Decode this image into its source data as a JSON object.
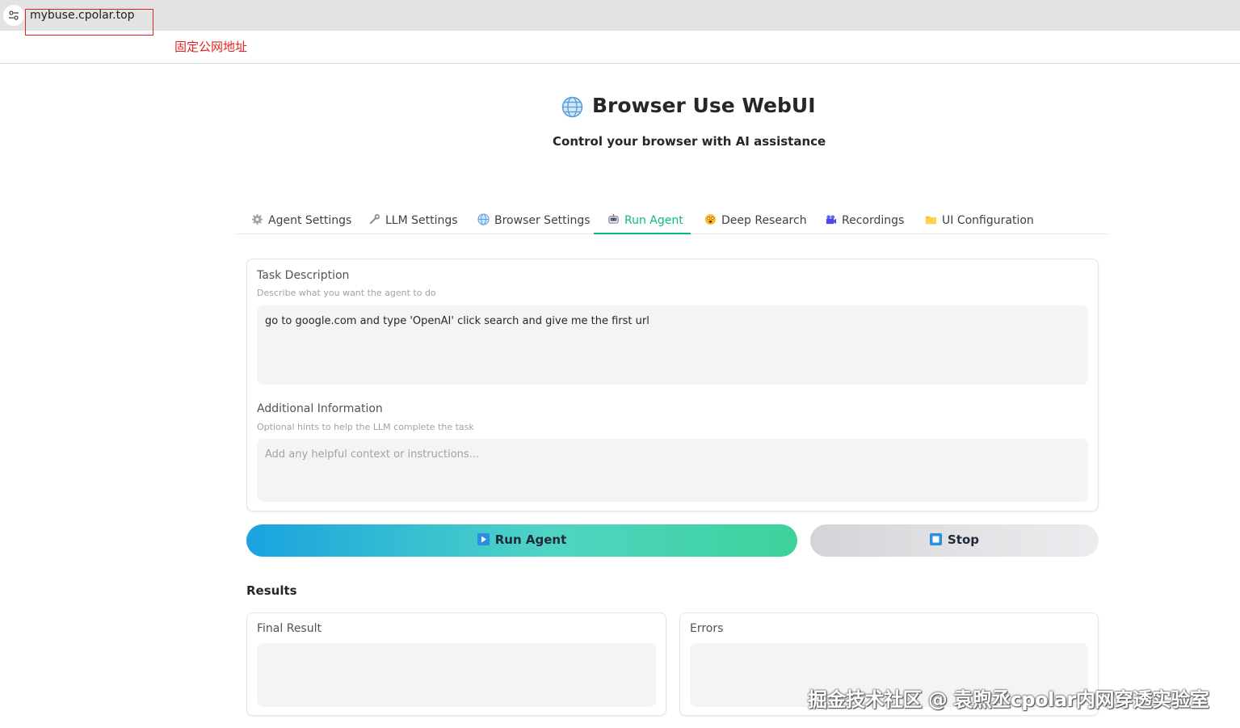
{
  "browser": {
    "url": "mybuse.cpolar.top",
    "annotation": "固定公网地址"
  },
  "header": {
    "title": "Browser Use WebUI",
    "subtitle": "Control your browser with AI assistance"
  },
  "tabs": [
    {
      "label": "Agent Settings",
      "icon": "gear-icon"
    },
    {
      "label": "LLM Settings",
      "icon": "wrench-icon"
    },
    {
      "label": "Browser Settings",
      "icon": "globe-icon"
    },
    {
      "label": "Run Agent",
      "icon": "robot-icon",
      "active": true
    },
    {
      "label": "Deep Research",
      "icon": "face-icon"
    },
    {
      "label": "Recordings",
      "icon": "camera-icon"
    },
    {
      "label": "UI Configuration",
      "icon": "folder-icon"
    }
  ],
  "task": {
    "label": "Task Description",
    "hint": "Describe what you want the agent to do",
    "value": "go to google.com and type 'OpenAI' click search and give me the first url"
  },
  "additional": {
    "label": "Additional Information",
    "hint": "Optional hints to help the LLM complete the task",
    "placeholder": "Add any helpful context or instructions..."
  },
  "buttons": {
    "run": "Run Agent",
    "stop": "Stop"
  },
  "results": {
    "heading": "Results",
    "final_label": "Final Result",
    "errors_label": "Errors"
  },
  "watermark": "掘金技术社区 @ 袁煦丞cpolar内网穿透实验室",
  "colors": {
    "accent": "#10b981",
    "annotation": "#e02424"
  }
}
